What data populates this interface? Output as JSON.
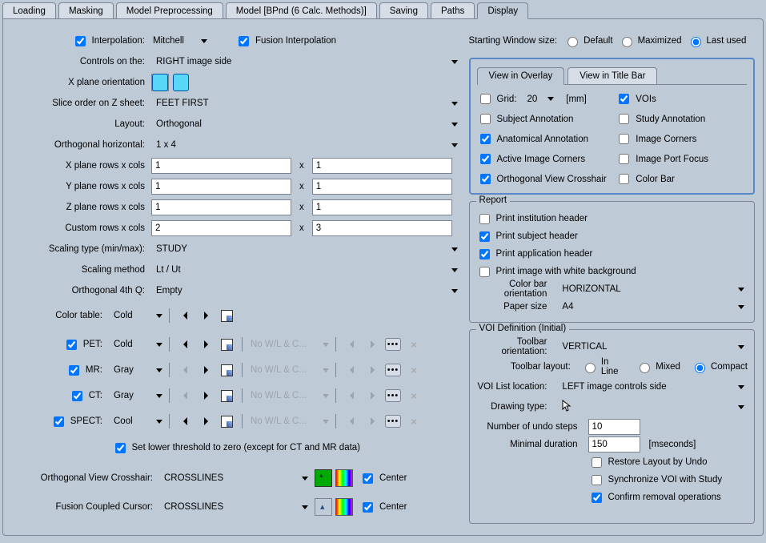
{
  "tabs": {
    "loading": "Loading",
    "masking": "Masking",
    "model_pre": "Model Preprocessing",
    "model": "Model  [BPnd (6 Calc. Methods)]",
    "saving": "Saving",
    "paths": "Paths",
    "display": "Display"
  },
  "left": {
    "interpolation_label": "Interpolation:",
    "interpolation_val": "Mitchell",
    "fusion_interp": "Fusion Interpolation",
    "controls_on_label": "Controls on the:",
    "controls_on_val": "RIGHT image side",
    "x_orient_label": "X plane orientation",
    "slice_order_label": "Slice order on Z sheet:",
    "slice_order_val": "FEET FIRST",
    "layout_label": "Layout:",
    "layout_val": "Orthogonal",
    "ortho_horiz_label": "Orthogonal horizontal:",
    "ortho_horiz_val": "1 x 4",
    "xrows_label": "X plane rows x cols",
    "yrows_label": "Y plane rows x cols",
    "zrows_label": "Z plane rows x cols",
    "crows_label": "Custom rows x cols",
    "xrows_a": "1",
    "xrows_b": "1",
    "yrows_a": "1",
    "yrows_b": "1",
    "zrows_a": "1",
    "zrows_b": "1",
    "crows_a": "2",
    "crows_b": "3",
    "x_char": "x",
    "scaling_type_label": "Scaling type (min/max):",
    "scaling_type_val": "STUDY",
    "scaling_method_label": "Scaling method",
    "scaling_method_val": "Lt / Ut",
    "ortho4q_label": "Orthogonal 4th Q:",
    "ortho4q_val": "Empty",
    "color_table_label": "Color table:",
    "color_table_val": "Cold",
    "pet_label": "PET:",
    "pet_val": "Cold",
    "mr_label": "MR:",
    "mr_val": "Gray",
    "ct_label": "CT:",
    "ct_val": "Gray",
    "spect_label": "SPECT:",
    "spect_val": "Cool",
    "nowlc": "No W/L & C...",
    "lower_thresh": "Set lower threshold to zero (except for CT and MR data)",
    "ortho_cross_label": "Orthogonal View Crosshair:",
    "ortho_cross_val": "CROSSLINES",
    "fusion_cursor_label": "Fusion Coupled Cursor:",
    "fusion_cursor_val": "CROSSLINES",
    "center_label": "Center"
  },
  "right": {
    "starting_label": "Starting Window size:",
    "opt_default": "Default",
    "opt_maxim": "Maximized",
    "opt_last": "Last used",
    "subtab_overlay": "View in Overlay",
    "subtab_title": "View in Title Bar",
    "grid_label": "Grid:",
    "grid_val": "20",
    "grid_unit": "[mm]",
    "vois": "VOIs",
    "subj_ann": "Subject Annotation",
    "study_ann": "Study Annotation",
    "anat_ann": "Anatomical Annotation",
    "img_corners": "Image Corners",
    "active_corners": "Active Image Corners",
    "port_focus": "Image Port Focus",
    "ortho_cross": "Orthogonal View Crosshair",
    "color_bar": "Color Bar",
    "report_title": "Report",
    "rpt_inst": "Print institution header",
    "rpt_subj": "Print subject header",
    "rpt_app": "Print application header",
    "rpt_white": "Print image with white background",
    "cb_orient_label": "Color bar orientation",
    "cb_orient_val": "HORIZONTAL",
    "paper_label": "Paper size",
    "paper_val": "A4",
    "voi_title": "VOI Definition (Initial)",
    "tb_orient_label": "Toolbar orientation:",
    "tb_orient_val": "VERTICAL",
    "tb_layout_label": "Toolbar layout:",
    "tb_inline": "In Line",
    "tb_mixed": "Mixed",
    "tb_compact": "Compact",
    "voi_list_label": "VOI List location:",
    "voi_list_val": "LEFT image controls side",
    "drawing_label": "Drawing type:",
    "undo_label": "Number of undo steps",
    "undo_val": "10",
    "mindur_label": "Minimal duration",
    "mindur_val": "150",
    "mindur_unit": "[mseconds]",
    "restore_undo": "Restore Layout by Undo",
    "sync_voi": "Synchronize VOI with Study",
    "confirm_rm": "Confirm removal operations"
  }
}
